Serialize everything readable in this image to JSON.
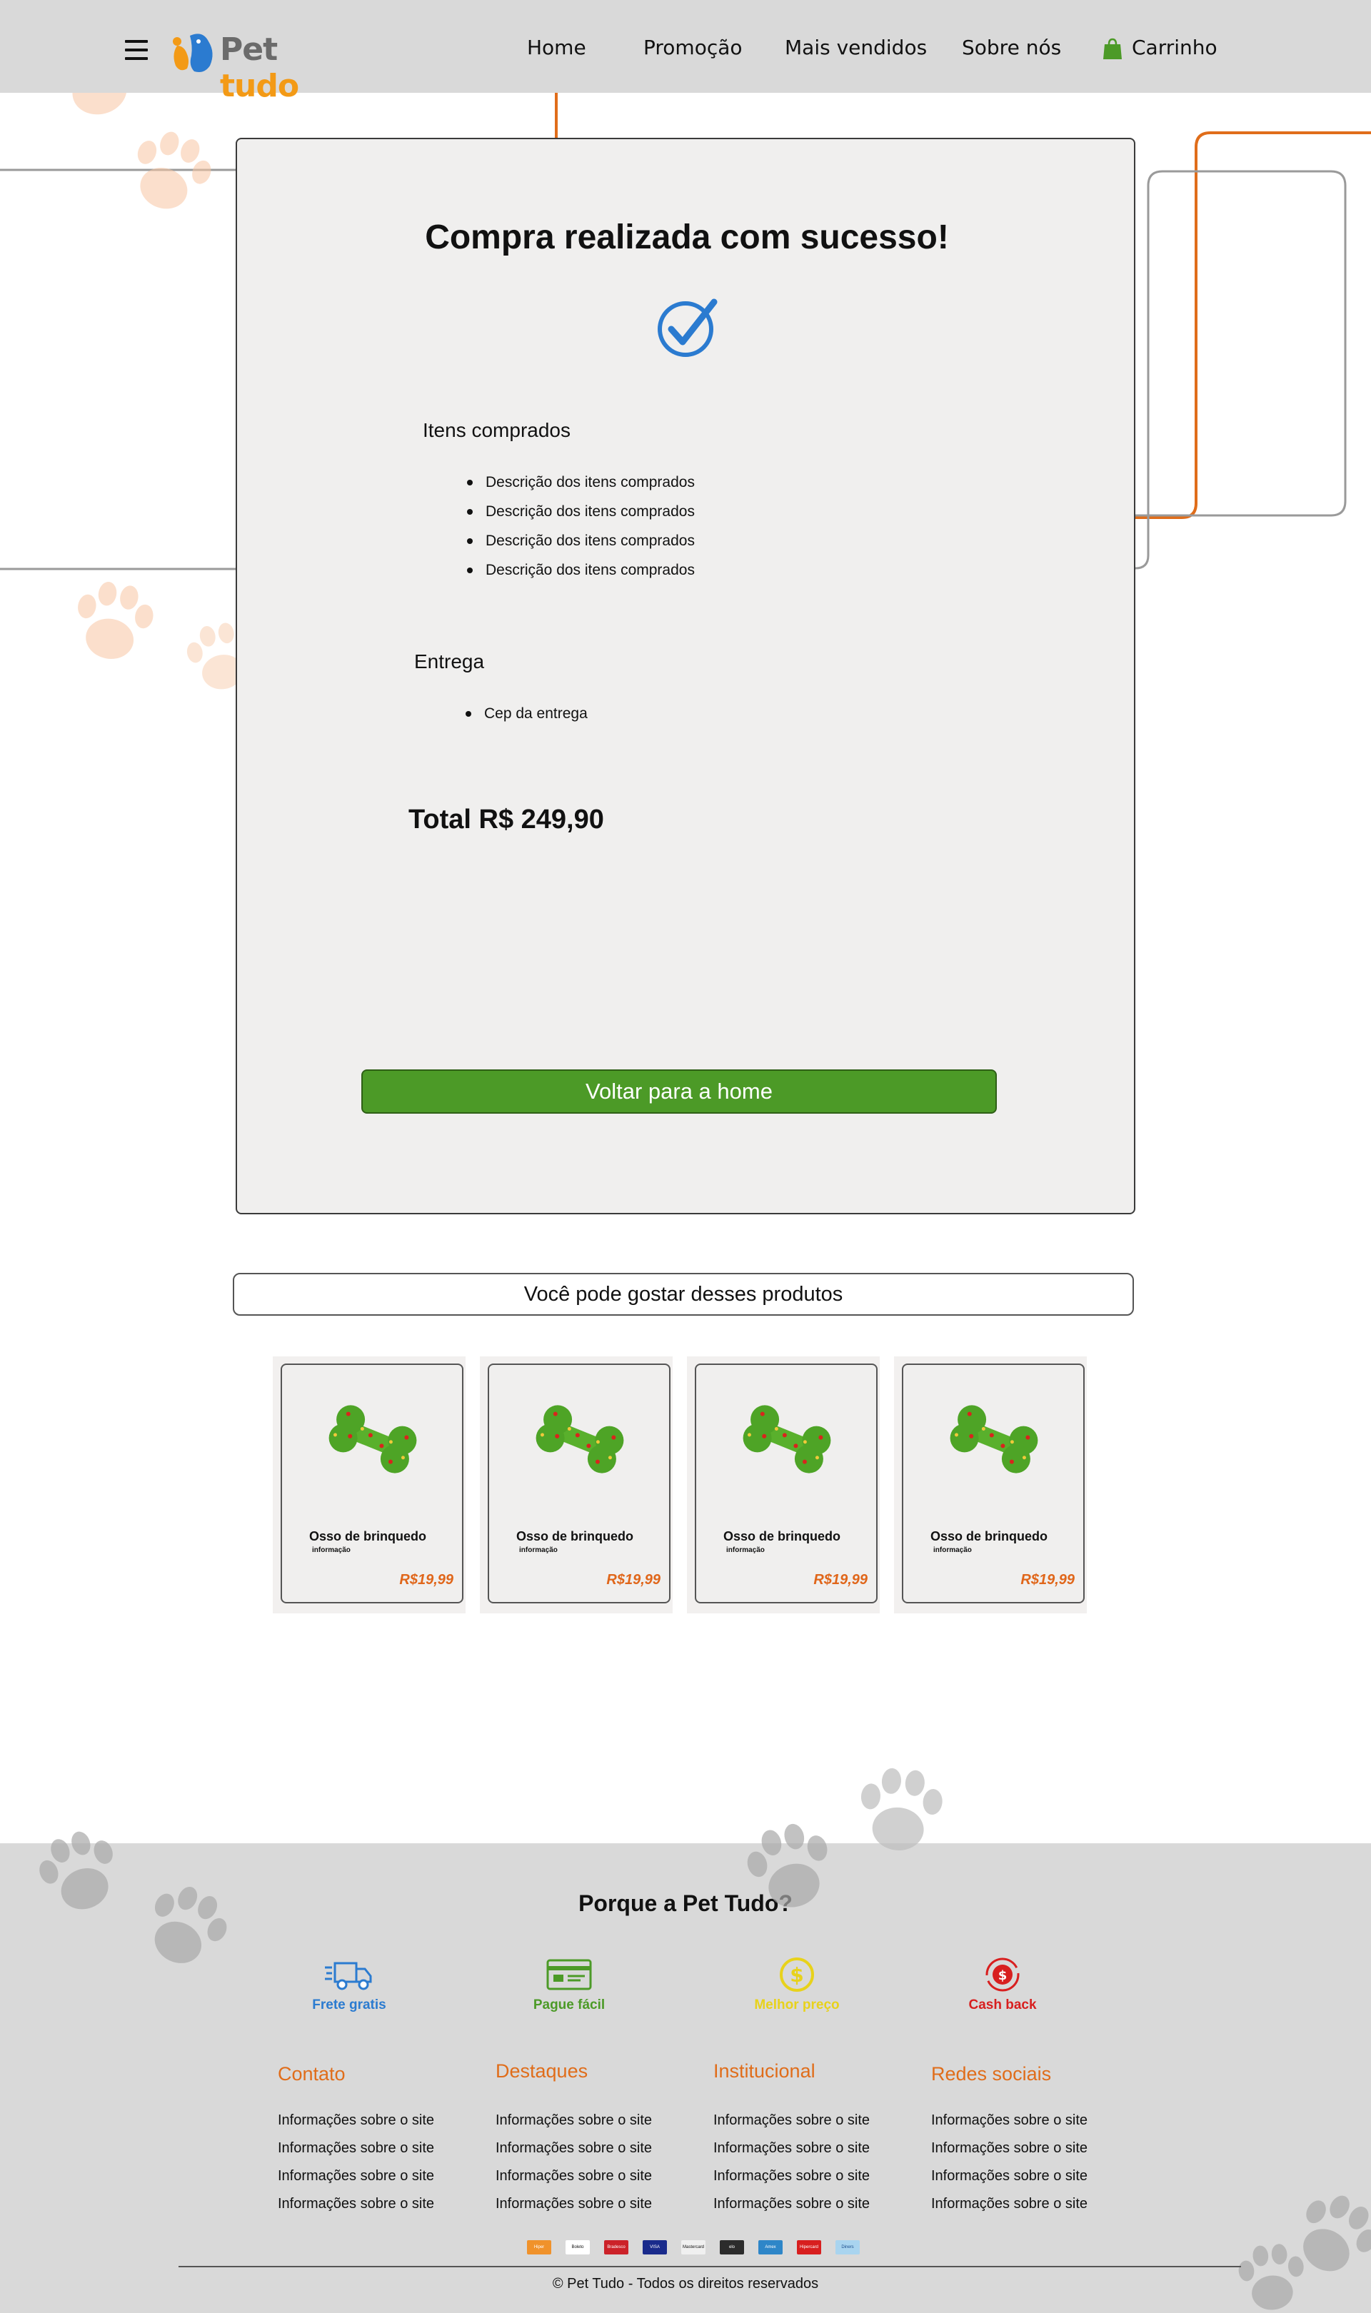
{
  "header": {
    "menu_icon": "hamburger-menu-icon",
    "logo": {
      "pet": "Pet",
      "tudo": "tudo"
    },
    "nav": [
      "Home",
      "Promoção",
      "Mais vendidos",
      "Sobre nós"
    ],
    "cart_label": "Carrinho",
    "cart_icon": "shopping-bag-icon"
  },
  "order": {
    "title": "Compra realizada com sucesso!",
    "check_icon": "check-circle-icon",
    "items_label": "Itens comprados",
    "items": [
      "Descrição dos itens comprados",
      "Descrição dos itens comprados",
      "Descrição dos itens comprados",
      "Descrição dos itens comprados"
    ],
    "delivery_label": "Entrega",
    "delivery_items": [
      "Cep da entrega"
    ],
    "total": "Total R$ 249,90",
    "back_button": "Voltar para a home"
  },
  "recommend": {
    "title": "Você pode gostar desses produtos",
    "products": [
      {
        "name": "Osso de brinquedo",
        "info": "informação",
        "price": "R$19,99"
      },
      {
        "name": "Osso de brinquedo",
        "info": "informação",
        "price": "R$19,99"
      },
      {
        "name": "Osso de brinquedo",
        "info": "informação",
        "price": "R$19,99"
      },
      {
        "name": "Osso de brinquedo",
        "info": "informação",
        "price": "R$19,99"
      }
    ]
  },
  "footer": {
    "why_title": "Porque a Pet Tudo?",
    "features": [
      {
        "label": "Frete gratis",
        "icon": "delivery-truck-icon",
        "color": "#2b7bd0"
      },
      {
        "label": "Pague fácil",
        "icon": "payment-card-icon",
        "color": "#4c9a27"
      },
      {
        "label": "Melhor preço",
        "icon": "dollar-coin-icon",
        "color": "#e8d21b"
      },
      {
        "label": "Cash back",
        "icon": "cashback-icon",
        "color": "#d81f1f"
      }
    ],
    "columns": [
      {
        "title": "Contato",
        "links": [
          "Informações sobre o site",
          "Informações sobre o site",
          "Informações sobre o site",
          "Informações sobre o site"
        ]
      },
      {
        "title": "Destaques",
        "links": [
          "Informações sobre o site",
          "Informações sobre o site",
          "Informações sobre o site",
          "Informações sobre o site"
        ]
      },
      {
        "title": "Institucional",
        "links": [
          "Informações sobre o site",
          "Informações sobre o site",
          "Informações sobre o site",
          "Informações sobre o site"
        ]
      },
      {
        "title": "Redes sociais",
        "links": [
          "Informações sobre o site",
          "Informações sobre o site",
          "Informações sobre o site",
          "Informações sobre o site"
        ]
      }
    ],
    "payments": [
      "Hiper",
      "Boleto",
      "Bradesco",
      "VISA",
      "Mastercard",
      "elo",
      "Amex",
      "Hipercard",
      "Diners"
    ],
    "copyright": "© Pet Tudo - Todos os direitos reservados"
  },
  "colors": {
    "header_bg": "#d9d9d9",
    "accent_orange": "#e0661a",
    "button_green": "#4c9a27",
    "card_bg": "#f0efee"
  }
}
